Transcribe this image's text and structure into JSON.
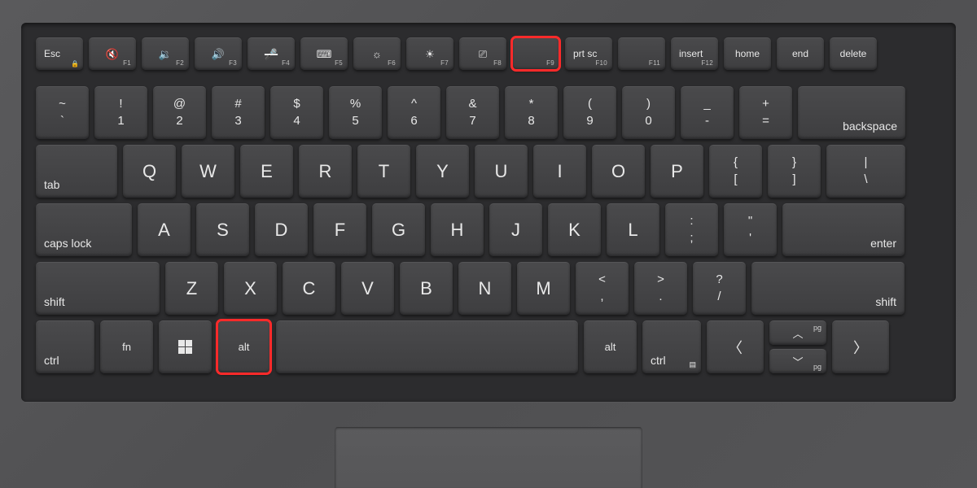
{
  "highlighted_keys": [
    "F9",
    "Alt (left)"
  ],
  "rows": {
    "function": [
      {
        "label": "Esc",
        "sub": "",
        "icon": "",
        "extra": "lock"
      },
      {
        "label": "",
        "sub": "F1",
        "icon": "speaker-mute"
      },
      {
        "label": "",
        "sub": "F2",
        "icon": "volume-down"
      },
      {
        "label": "",
        "sub": "F3",
        "icon": "volume-up"
      },
      {
        "label": "",
        "sub": "F4",
        "icon": "mic-mute"
      },
      {
        "label": "",
        "sub": "F5",
        "icon": "keyboard-backlight"
      },
      {
        "label": "",
        "sub": "F6",
        "icon": "brightness-down"
      },
      {
        "label": "",
        "sub": "F7",
        "icon": "brightness-up"
      },
      {
        "label": "",
        "sub": "F8",
        "icon": "display-switch"
      },
      {
        "label": "",
        "sub": "F9",
        "icon": "",
        "highlighted": true
      },
      {
        "label": "prt sc",
        "sub": "F10",
        "icon": ""
      },
      {
        "label": "",
        "sub": "F11",
        "icon": ""
      },
      {
        "label": "insert",
        "sub": "F12",
        "icon": ""
      },
      {
        "label": "home",
        "sub": "",
        "icon": ""
      },
      {
        "label": "end",
        "sub": "",
        "icon": ""
      },
      {
        "label": "delete",
        "sub": "",
        "icon": ""
      }
    ],
    "numbers": [
      {
        "top": "~",
        "bottom": "`"
      },
      {
        "top": "!",
        "bottom": "1"
      },
      {
        "top": "@",
        "bottom": "2"
      },
      {
        "top": "#",
        "bottom": "3"
      },
      {
        "top": "$",
        "bottom": "4"
      },
      {
        "top": "%",
        "bottom": "5"
      },
      {
        "top": "^",
        "bottom": "6"
      },
      {
        "top": "&",
        "bottom": "7"
      },
      {
        "top": "*",
        "bottom": "8"
      },
      {
        "top": "(",
        "bottom": "9"
      },
      {
        "top": ")",
        "bottom": "0"
      },
      {
        "top": "_",
        "bottom": "-"
      },
      {
        "top": "+",
        "bottom": "="
      },
      {
        "label": "backspace",
        "wide": "bksp"
      }
    ],
    "qwerty": [
      {
        "label": "tab",
        "wide": "tab"
      },
      {
        "letter": "Q"
      },
      {
        "letter": "W"
      },
      {
        "letter": "E"
      },
      {
        "letter": "R"
      },
      {
        "letter": "T"
      },
      {
        "letter": "Y"
      },
      {
        "letter": "U"
      },
      {
        "letter": "I"
      },
      {
        "letter": "O"
      },
      {
        "letter": "P"
      },
      {
        "top": "{",
        "bottom": "["
      },
      {
        "top": "}",
        "bottom": "]"
      },
      {
        "top": "|",
        "bottom": "\\"
      }
    ],
    "asdf": [
      {
        "label": "caps lock",
        "wide": "caps"
      },
      {
        "letter": "A"
      },
      {
        "letter": "S"
      },
      {
        "letter": "D"
      },
      {
        "letter": "F"
      },
      {
        "letter": "G"
      },
      {
        "letter": "H"
      },
      {
        "letter": "J"
      },
      {
        "letter": "K"
      },
      {
        "letter": "L"
      },
      {
        "top": ":",
        "bottom": ";"
      },
      {
        "top": "\"",
        "bottom": "'"
      },
      {
        "label": "enter",
        "wide": "enter",
        "align": "right"
      }
    ],
    "zxcv": [
      {
        "label": "shift",
        "wide": "shiftL"
      },
      {
        "letter": "Z"
      },
      {
        "letter": "X"
      },
      {
        "letter": "C"
      },
      {
        "letter": "V"
      },
      {
        "letter": "B"
      },
      {
        "letter": "N"
      },
      {
        "letter": "M"
      },
      {
        "top": "<",
        "bottom": ","
      },
      {
        "top": ">",
        "bottom": "."
      },
      {
        "top": "?",
        "bottom": "/"
      },
      {
        "label": "shift",
        "wide": "shiftR",
        "align": "right"
      }
    ],
    "bottom": [
      {
        "label": "ctrl",
        "w": "ctrl"
      },
      {
        "label": "fn",
        "w": "mod"
      },
      {
        "label": "",
        "icon": "windows",
        "w": "mod"
      },
      {
        "label": "alt",
        "w": "mod",
        "highlighted": true
      },
      {
        "label": "",
        "w": "space"
      },
      {
        "label": "alt",
        "w": "mod"
      },
      {
        "label": "ctrl",
        "w": "ctrl",
        "extra": "context"
      },
      {
        "label": "<",
        "w": "arrow"
      },
      {
        "stack": [
          {
            "label": "^",
            "pg": "pg"
          },
          {
            "label": "v",
            "pg": "pg"
          }
        ]
      },
      {
        "label": ">",
        "w": "arrow"
      }
    ]
  }
}
